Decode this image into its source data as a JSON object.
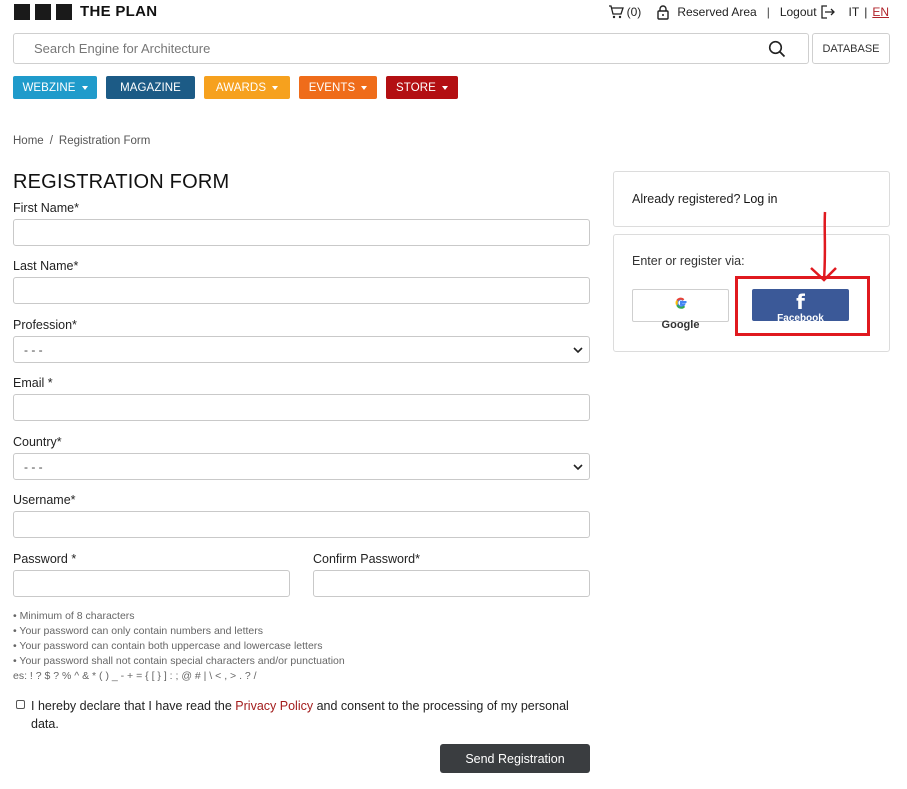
{
  "header": {
    "brand": "THE PLAN",
    "cart_count": "(0)",
    "reserved_area": "Reserved Area",
    "separator": "|",
    "logout": "Logout",
    "lang_it": "IT",
    "lang_sep": "|",
    "lang_en": "EN"
  },
  "search": {
    "placeholder": "Search Engine for Architecture",
    "database_label": "DATABASE"
  },
  "categories": [
    {
      "label": "WEBZINE",
      "color": "#1f9bcb",
      "dropdown": true
    },
    {
      "label": "MAGAZINE",
      "color": "#1c5b86",
      "dropdown": false
    },
    {
      "label": "AWARDS",
      "color": "#f6a11e",
      "dropdown": true
    },
    {
      "label": "EVENTS",
      "color": "#ef6c1a",
      "dropdown": true
    },
    {
      "label": "STORE",
      "color": "#b30f12",
      "dropdown": true
    }
  ],
  "breadcrumb": {
    "home": "Home",
    "separator": "/",
    "current": "Registration Form"
  },
  "form": {
    "title": "REGISTRATION FORM",
    "first_name_label": "First Name*",
    "last_name_label": "Last Name*",
    "profession_label": "Profession*",
    "profession_value": "- - -",
    "email_label": "Email *",
    "country_label": "Country*",
    "country_value": "- - -",
    "username_label": "Username*",
    "password_label": "Password *",
    "confirm_password_label": "Confirm Password*",
    "rules": [
      "• Minimum of 8 characters",
      "• Your password can only contain numbers and letters",
      "• Your password can contain both uppercase and lowercase letters",
      "• Your password shall not contain special characters and/or punctuation",
      "es: ! ? $ ? % ^ & * ( ) _ - + = { [ } ] : ; @ # | \\ < , > . ? /"
    ],
    "consent_prefix": "I hereby declare that I have read the ",
    "consent_link": "Privacy Policy",
    "consent_suffix": " and consent to the processing of my personal data.",
    "submit_label": "Send Registration"
  },
  "sidebar": {
    "already_registered": "Already registered?",
    "login_link": "Log in",
    "enter_via": "Enter or register via:",
    "google_label": "Google",
    "facebook_label": "Facebook"
  },
  "colors": {
    "facebook": "#3b5998",
    "annotation": "#e0191f",
    "submit_bg": "#3a3d40",
    "link_red": "#a31d1d"
  },
  "icons": [
    "cart-icon",
    "lock-icon",
    "logout-icon",
    "search-icon",
    "chevron-down-icon",
    "google-icon",
    "facebook-icon",
    "annotation-arrow"
  ]
}
